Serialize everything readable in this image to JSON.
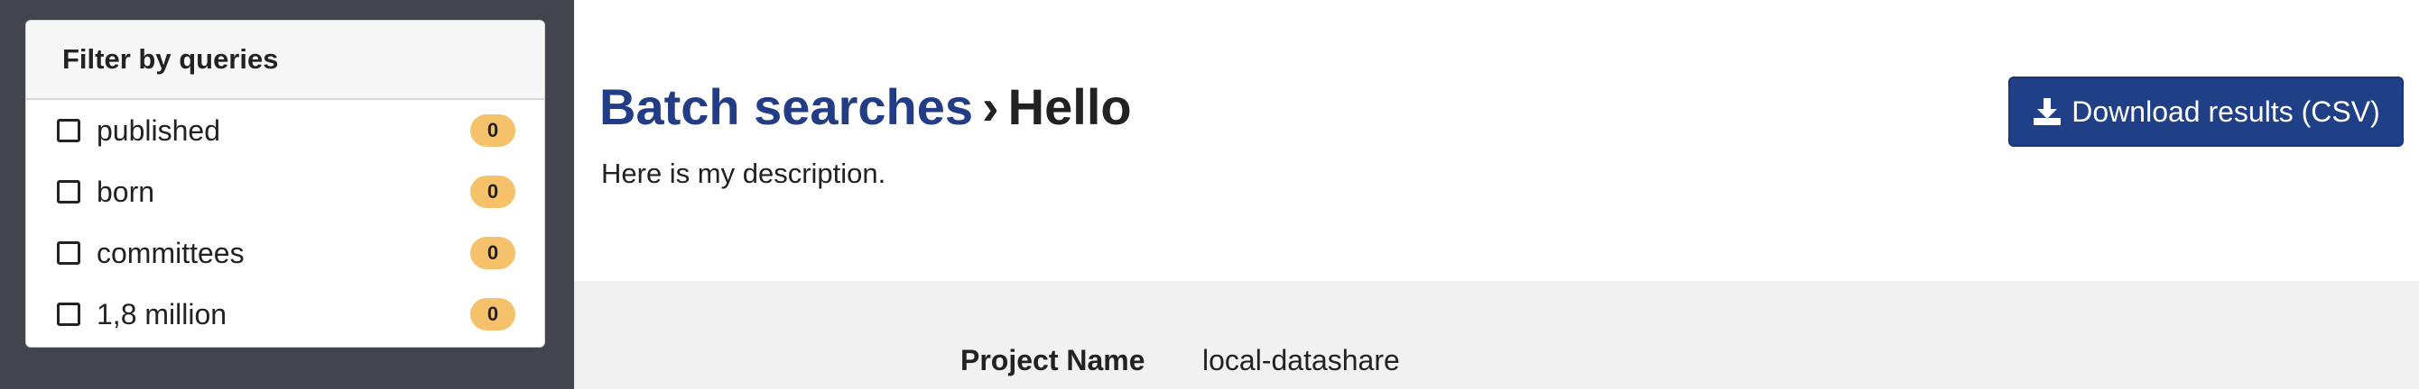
{
  "filter": {
    "title": "Filter by queries",
    "queries": [
      {
        "label": "published",
        "count": "0"
      },
      {
        "label": "born",
        "count": "0"
      },
      {
        "label": "committees",
        "count": "0"
      },
      {
        "label": "1,8 million",
        "count": "0"
      }
    ]
  },
  "header": {
    "breadcrumb_link": "Batch searches",
    "breadcrumb_separator": "›",
    "title": "Hello",
    "description": "Here is my description.",
    "download_label": "Download results (CSV)"
  },
  "details": {
    "project_name_label": "Project Name",
    "project_name_value": "local-datashare"
  },
  "colors": {
    "sidebar_bg": "#43444d",
    "brand": "#223d85",
    "badge": "#f5c16a",
    "details_bg": "#f2f1f2"
  }
}
